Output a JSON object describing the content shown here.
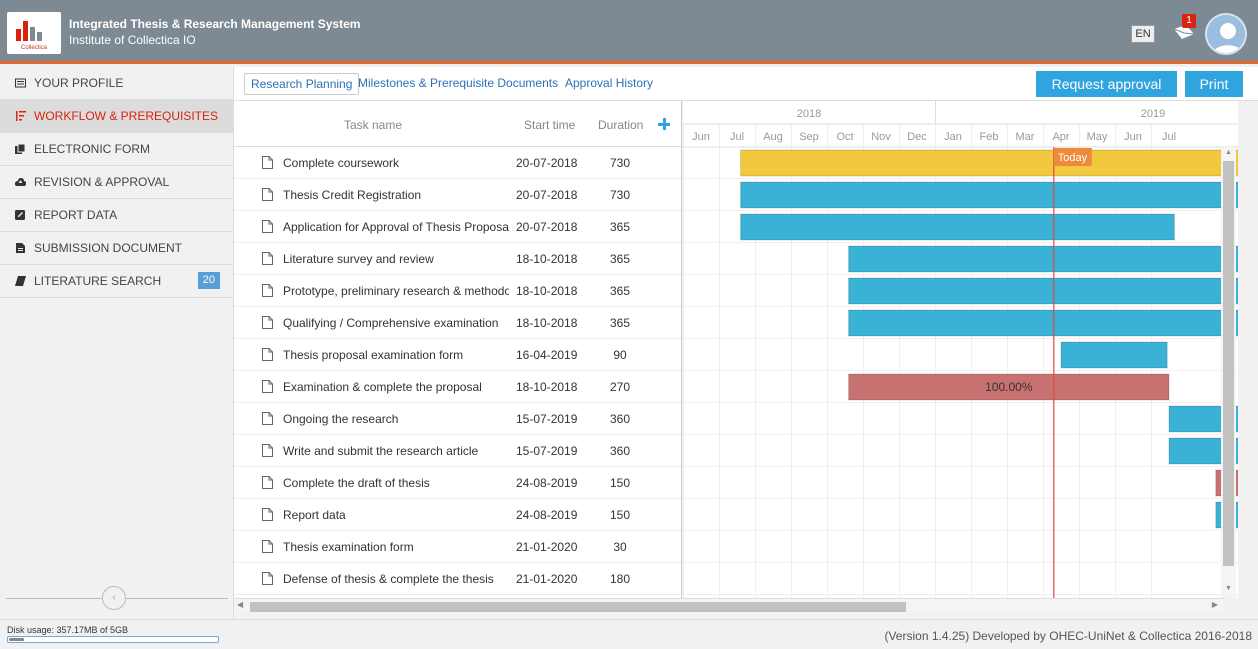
{
  "header": {
    "title": "Integrated Thesis & Research Management System",
    "subtitle": "Institute of Collectica IO",
    "logo_text": "Collectica",
    "lang": "EN",
    "mail_count": "1"
  },
  "sidebar": {
    "items": [
      {
        "label": "YOUR PROFILE",
        "icon": "id-card-icon"
      },
      {
        "label": "WORKFLOW & PREREQUISITES",
        "icon": "sort-icon",
        "active": true
      },
      {
        "label": "ELECTRONIC FORM",
        "icon": "files-icon"
      },
      {
        "label": "REVISION & APPROVAL",
        "icon": "cloud-upload-icon"
      },
      {
        "label": "REPORT DATA",
        "icon": "edit-icon"
      },
      {
        "label": "SUBMISSION DOCUMENT",
        "icon": "document-icon"
      },
      {
        "label": "LITERATURE SEARCH",
        "icon": "book-icon",
        "badge": "20"
      }
    ],
    "collapse_glyph": "‹"
  },
  "tabs": {
    "items": [
      "Research Planning",
      "Milestones & Prerequisite Documents",
      "Approval History"
    ],
    "active": 0
  },
  "actions": {
    "request_approval": "Request approval",
    "print": "Print"
  },
  "grid": {
    "columns": {
      "task": "Task name",
      "start": "Start time",
      "duration": "Duration"
    },
    "rows": [
      {
        "name": "Complete coursework",
        "start": "20-07-2018",
        "duration": "730"
      },
      {
        "name": "Thesis Credit Registration",
        "start": "20-07-2018",
        "duration": "730"
      },
      {
        "name": "Application for Approval of Thesis Proposal",
        "start": "20-07-2018",
        "duration": "365"
      },
      {
        "name": "Literature survey and review",
        "start": "18-10-2018",
        "duration": "365"
      },
      {
        "name": "Prototype, preliminary research & methodology",
        "start": "18-10-2018",
        "duration": "365"
      },
      {
        "name": "Qualifying / Comprehensive examination",
        "start": "18-10-2018",
        "duration": "365"
      },
      {
        "name": "Thesis proposal examination form",
        "start": "16-04-2019",
        "duration": "90"
      },
      {
        "name": "Examination & complete the proposal",
        "start": "18-10-2018",
        "duration": "270"
      },
      {
        "name": "Ongoing the research",
        "start": "15-07-2019",
        "duration": "360"
      },
      {
        "name": "Write and submit the research article",
        "start": "15-07-2019",
        "duration": "360"
      },
      {
        "name": "Complete the draft of thesis",
        "start": "24-08-2019",
        "duration": "150"
      },
      {
        "name": "Report data",
        "start": "24-08-2019",
        "duration": "150"
      },
      {
        "name": "Thesis examination form",
        "start": "21-01-2020",
        "duration": "30"
      },
      {
        "name": "Defense of thesis & complete the thesis",
        "start": "21-01-2020",
        "duration": "180"
      }
    ]
  },
  "gantt": {
    "years": [
      "2018",
      "2019"
    ],
    "months": [
      "Jun",
      "Jul",
      "Aug",
      "Sep",
      "Oct",
      "Nov",
      "Dec",
      "Jan",
      "Feb",
      "Mar",
      "Apr",
      "May",
      "Jun",
      "Jul"
    ],
    "today_label": "Today",
    "today_month": 10.3,
    "bars": [
      {
        "row": 0,
        "start": 1.6,
        "end": 17,
        "color": "#f2c83e"
      },
      {
        "row": 1,
        "start": 1.6,
        "end": 17,
        "color": "#3ab2d6"
      },
      {
        "row": 2,
        "start": 1.6,
        "end": 13.65,
        "color": "#3ab2d6"
      },
      {
        "row": 3,
        "start": 4.6,
        "end": 17,
        "color": "#3ab2d6"
      },
      {
        "row": 4,
        "start": 4.6,
        "end": 17,
        "color": "#3ab2d6"
      },
      {
        "row": 5,
        "start": 4.6,
        "end": 17,
        "color": "#3ab2d6"
      },
      {
        "row": 6,
        "start": 10.5,
        "end": 13.45,
        "color": "#3ab2d6"
      },
      {
        "row": 7,
        "start": 4.6,
        "end": 13.5,
        "color": "#c87171",
        "label": "100.00%"
      },
      {
        "row": 8,
        "start": 13.5,
        "end": 17,
        "color": "#3ab2d6"
      },
      {
        "row": 9,
        "start": 13.5,
        "end": 17,
        "color": "#3ab2d6"
      },
      {
        "row": 10,
        "start": 14.8,
        "end": 17,
        "color": "#c87171"
      },
      {
        "row": 11,
        "start": 14.8,
        "end": 17,
        "color": "#3ab2d6"
      }
    ]
  },
  "footer": {
    "disk_usage": "Disk usage: 357.17MB of 5GB",
    "disk_fraction": 0.07,
    "version": "(Version 1.4.25) Developed by OHEC-UniNet & Collectica 2016-2018"
  }
}
